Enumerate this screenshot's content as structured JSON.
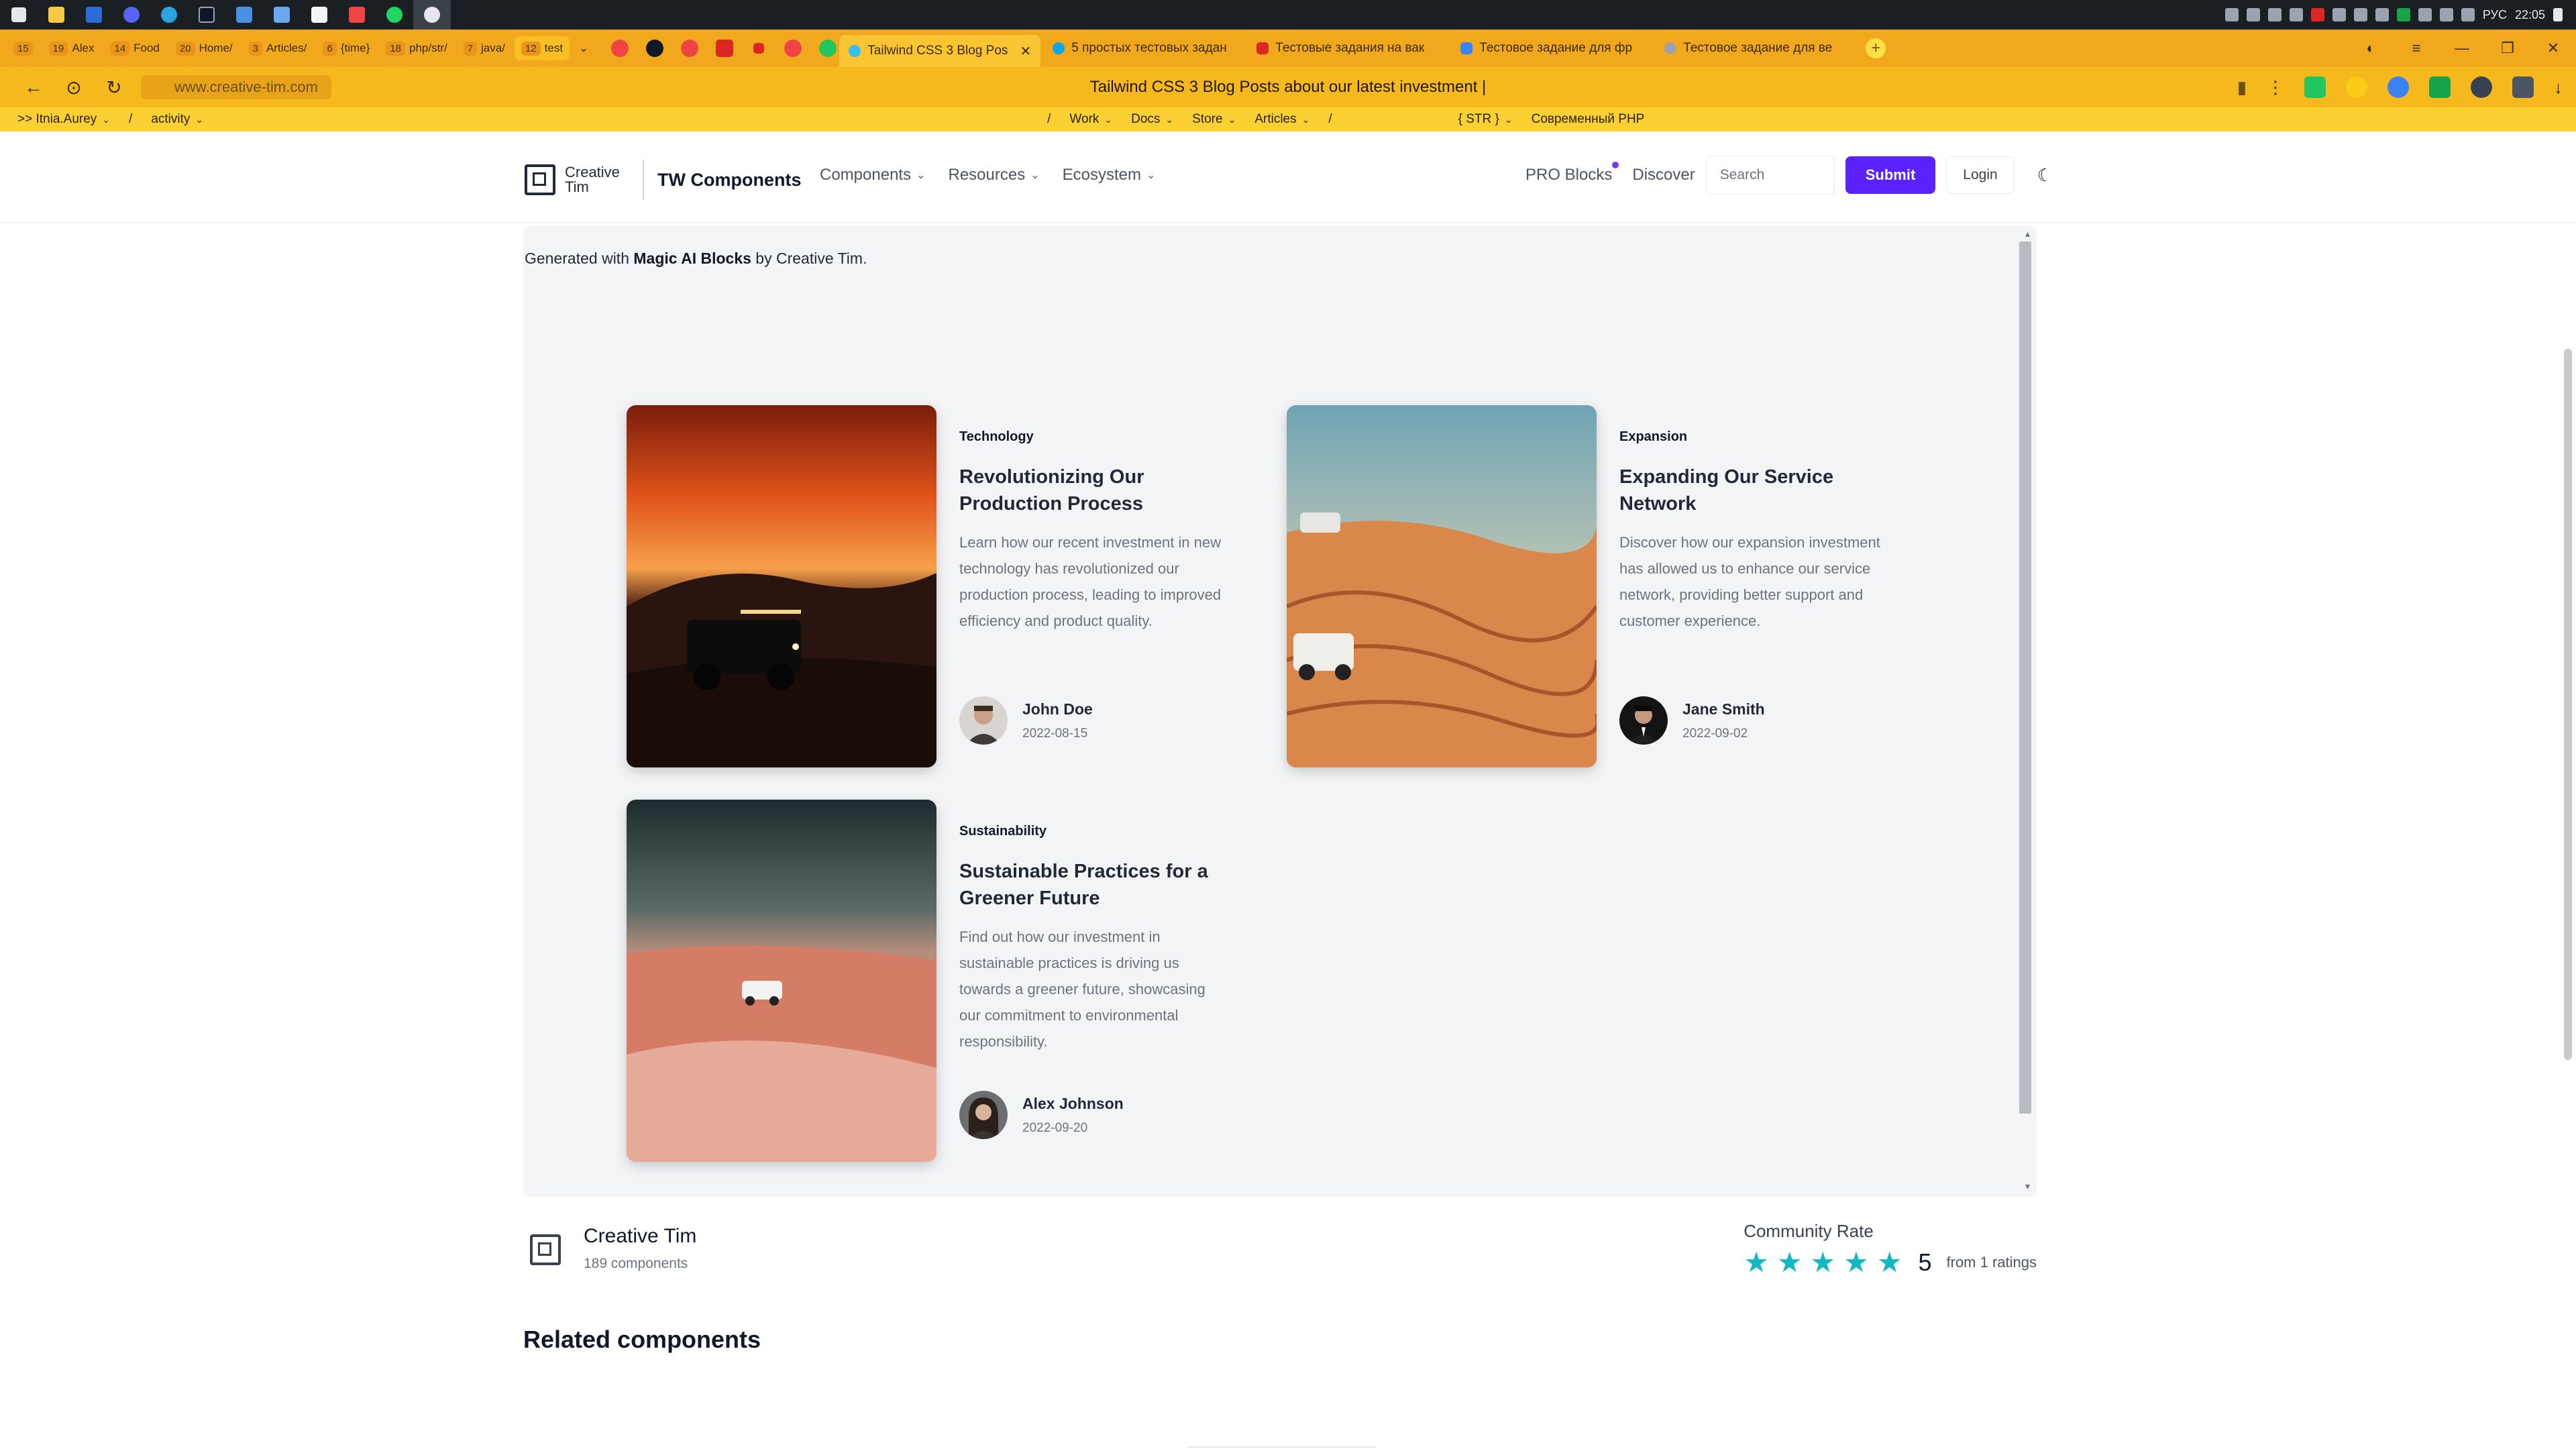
{
  "taskbar": {
    "clock": "22:05",
    "lang": "РУС",
    "apps": [
      "windows-start",
      "file-explorer",
      "word",
      "discord",
      "telegram",
      "terminal",
      "doc",
      "notes",
      "app-t",
      "recorder",
      "spotify",
      "yandex-browser"
    ]
  },
  "browser": {
    "pinned_tabs": [
      {
        "num": "15",
        "label": ""
      },
      {
        "num": "19",
        "label": "Alex"
      },
      {
        "num": "14",
        "label": "Food"
      },
      {
        "num": "20",
        "label": "Home/"
      },
      {
        "num": "3",
        "label": "Articles/"
      },
      {
        "num": "6",
        "label": "{time}"
      },
      {
        "num": "18",
        "label": "php/str/"
      },
      {
        "num": "7",
        "label": "java/"
      },
      {
        "num": "12",
        "label": "test"
      }
    ],
    "tabs": [
      {
        "label": "Tailwind CSS 3 Blog Pos",
        "active": true
      },
      {
        "label": "5 простых тестовых задан",
        "active": false
      },
      {
        "label": "Тестовые задания на вак",
        "active": false
      },
      {
        "label": "Тестовое задание для фр",
        "active": false
      },
      {
        "label": "Тестовое задание для ве",
        "active": false
      }
    ],
    "url": "www.creative-tim.com",
    "page_title": "Tailwind CSS 3 Blog Posts about our latest investment |",
    "bookmarks": {
      "left": [
        {
          "label": ">>  Itnia.Aurey",
          "chevron": true
        },
        {
          "label": "/",
          "chevron": false
        },
        {
          "label": "activity",
          "chevron": true
        }
      ],
      "center": [
        {
          "label": "/",
          "chevron": false
        },
        {
          "label": "Work",
          "chevron": true
        },
        {
          "label": "Docs",
          "chevron": true
        },
        {
          "label": "Store",
          "chevron": true
        },
        {
          "label": "Articles",
          "chevron": true
        },
        {
          "label": "/",
          "chevron": false
        },
        {
          "label": "{ STR }",
          "chevron": true
        },
        {
          "label": "Современный PHP",
          "chevron": false
        }
      ]
    }
  },
  "site": {
    "brand": "Creative Tim",
    "product": "TW Components",
    "nav": [
      {
        "label": "Components"
      },
      {
        "label": "Resources"
      },
      {
        "label": "Ecosystem"
      }
    ],
    "pro_blocks": "PRO Blocks",
    "discover": "Discover",
    "search_placeholder": "Search",
    "submit": "Submit",
    "login": "Login"
  },
  "preview": {
    "generated_prefix": "Generated with ",
    "generated_bold": "Magic AI Blocks",
    "generated_suffix": " by Creative Tim.",
    "posts": [
      {
        "category": "Technology",
        "title": "Revolutionizing Our Production Process",
        "excerpt": "Learn how our recent investment in new technology has revolutionized our production process, leading to improved efficiency and product quality.",
        "author": "John Doe",
        "date": "2022-08-15"
      },
      {
        "category": "Expansion",
        "title": "Expanding Our Service Network",
        "excerpt": "Discover how our expansion investment has allowed us to enhance our service network, providing better support and customer experience.",
        "author": "Jane Smith",
        "date": "2022-09-02"
      },
      {
        "category": "Sustainability",
        "title": "Sustainable Practices for a Greener Future",
        "excerpt": "Find out how our investment in sustainable practices is driving us towards a greener future, showcasing our commitment to environmental responsibility.",
        "author": "Alex Johnson",
        "date": "2022-09-20"
      }
    ]
  },
  "footer": {
    "author_name": "Creative Tim",
    "components_count": "189 components",
    "community_label": "Community Rate",
    "rating": "5",
    "rating_fraction": 1.0,
    "ratings_text": "from 1 ratings",
    "related_title": "Related components"
  },
  "colors": {
    "tab_bar": "#f2a81d",
    "address_bar": "#f5b81d",
    "bookmark_bar": "#fbd033",
    "submit_button": "#5b21ff",
    "star": "#14b8c4",
    "preview_bg": "#f3f4f6"
  }
}
